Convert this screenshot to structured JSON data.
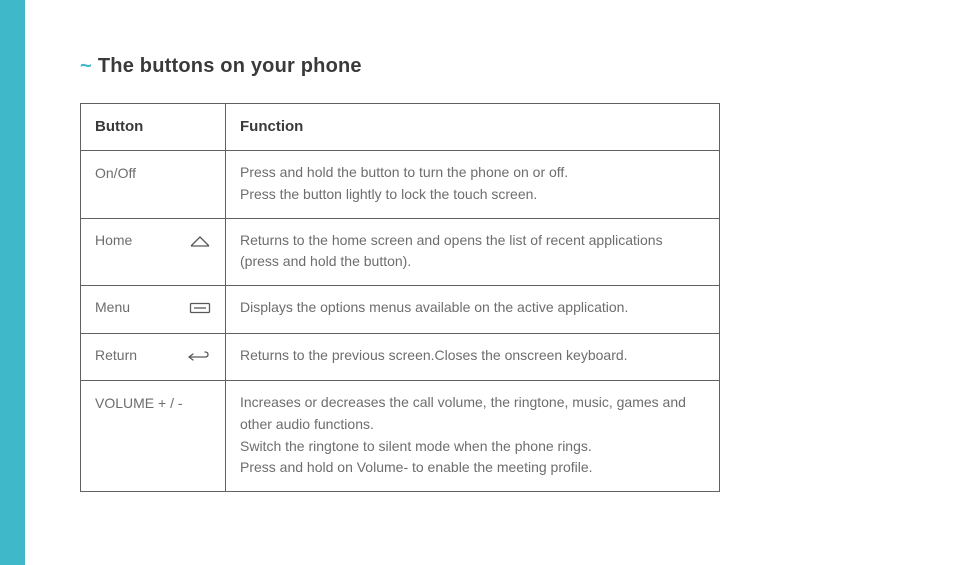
{
  "colors": {
    "accent": "#3fb8c9",
    "stroke": "#58595b"
  },
  "heading": {
    "tilde": "~",
    "text": "The buttons on your phone"
  },
  "table": {
    "headers": {
      "button": "Button",
      "function": "Function"
    },
    "rows": [
      {
        "button": "On/Off",
        "function": "Press and hold the button to turn the phone on or off.\nPress the button lightly to lock the touch screen.",
        "icon": null
      },
      {
        "button": "Home",
        "function": "Returns to the home screen and opens the list of recent applications (press and hold the button).",
        "icon": "home"
      },
      {
        "button": "Menu",
        "function": "Displays the options menus available on the active application.",
        "icon": "menu"
      },
      {
        "button": "Return",
        "function": "Returns to the previous screen.Closes the onscreen keyboard.",
        "icon": "return"
      },
      {
        "button": "VOLUME + / -",
        "function": "Increases or decreases the call volume, the ringtone, music, games and other audio functions.\nSwitch the ringtone to silent mode when the phone rings.\nPress and hold on Volume- to enable the meeting profile.",
        "icon": null,
        "justify": true
      }
    ]
  }
}
